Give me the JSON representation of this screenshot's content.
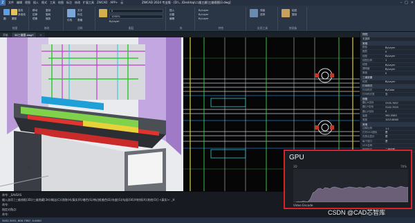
{
  "app": {
    "logo": "Z",
    "title": "ZWCAD 2024 专业版 - [D:\\...\\Desktop\\二维三维\\三维视图\\3.dwg]",
    "menu": [
      "文件",
      "编辑",
      "视图",
      "插入",
      "格式",
      "工具",
      "绘图",
      "标注",
      "修改",
      "扩展工具",
      "ZWCAD",
      "APP+",
      "云"
    ],
    "window_controls": [
      "–",
      "□",
      "×"
    ]
  },
  "ribbon": {
    "groups": [
      {
        "label": "绘图",
        "items": [
          "直线",
          "多段线",
          "圆",
          "圆弧"
        ]
      },
      {
        "label": "修改",
        "items": [
          "移动",
          "复制",
          "拉伸",
          "旋转",
          "镜像",
          "缩放"
        ]
      },
      {
        "label": "注释",
        "items": [
          "文字",
          "标注",
          "引线",
          "表格"
        ]
      },
      {
        "label": "图层",
        "items": [
          "图层特性",
          "0",
          "ByLayer"
        ]
      },
      {
        "label": "块",
        "items": [
          "插入",
          "创建",
          "编辑"
        ]
      },
      {
        "label": "特性",
        "items": [
          "ByLayer",
          "ByLayer",
          "ByLayer"
        ]
      },
      {
        "label": "实用工具",
        "items": [
          "测量",
          "选择"
        ]
      },
      {
        "label": "剪贴板",
        "items": [
          "粘贴",
          "复制"
        ]
      }
    ],
    "layer_value": "0",
    "scale_value": "1000%"
  },
  "tabs": [
    {
      "label": "开始"
    },
    {
      "label": "3D三维图.dwg*",
      "active": true
    },
    {
      "label": "+"
    }
  ],
  "command": {
    "lines": [
      "命令: _SAVEAS",
      "输入选项 [三维线框(3D)/三维隐藏(3H)/概念(C)/消隐(H)/真实(R)/着色(S)/带边框着色(E)/灰度(G)/勾画(SK)/X射线(X)/其他(O)] <真实>: _H",
      "命令:",
      "指定对角点:"
    ],
    "prompt": "命令:"
  },
  "status": {
    "coords": "3452.3451, 600.7387, 0.0000"
  },
  "properties": {
    "title": "特性",
    "selection": "无选择",
    "sections": [
      {
        "name": "常规",
        "rows": [
          [
            "颜色",
            "ByLayer"
          ],
          [
            "图层",
            "0"
          ],
          [
            "线型",
            "ByLayer"
          ],
          [
            "线型比例",
            "1"
          ],
          [
            "线宽",
            "ByLayer"
          ],
          [
            "透明度",
            "ByLayer"
          ],
          [
            "厚度",
            "0"
          ]
        ]
      },
      {
        "name": "三维效果",
        "rows": [
          [
            "材质",
            "ByLayer"
          ]
        ]
      },
      {
        "name": "打印样式",
        "rows": [
          [
            "打印样式",
            "ByColor"
          ],
          [
            "打印样式表",
            "无"
          ]
        ]
      },
      {
        "name": "视图",
        "rows": [
          [
            "圆心X坐标",
            "3335.7657"
          ],
          [
            "圆心Y坐标",
            "3142.7025"
          ],
          [
            "圆心Z坐标",
            "0"
          ],
          [
            "高度",
            "361.5583"
          ],
          [
            "宽度",
            "1015.8060"
          ]
        ]
      },
      {
        "name": "其他",
        "rows": [
          [
            "注释比例",
            "1:1"
          ],
          [
            "打开UCS图标",
            "是"
          ],
          [
            "在原点显示",
            "是"
          ],
          [
            "每个视口",
            "是"
          ],
          [
            "UCS名称",
            ""
          ],
          [
            "视觉样式",
            "二维线框"
          ]
        ]
      }
    ]
  },
  "gpu": {
    "title": "GPU",
    "label_3d": "3D",
    "percent": "70%",
    "video_label": "Video Encode",
    "usage": [
      0,
      0,
      2,
      1,
      3,
      2,
      1,
      10,
      28,
      32,
      40,
      42,
      38,
      44,
      43,
      40,
      45,
      46,
      44,
      42,
      40,
      43,
      44,
      46,
      45,
      44,
      43,
      45,
      44,
      42,
      46,
      47,
      44,
      43,
      44,
      46,
      45,
      43,
      44,
      47,
      46,
      44,
      43,
      45,
      48,
      46,
      44,
      45
    ]
  },
  "watermark": "CSDN @CAD芯智库",
  "colors": {
    "accent": "#3a6fb5",
    "gpu_border": "#d9232a",
    "gpu_fill": "#6b5f78"
  }
}
